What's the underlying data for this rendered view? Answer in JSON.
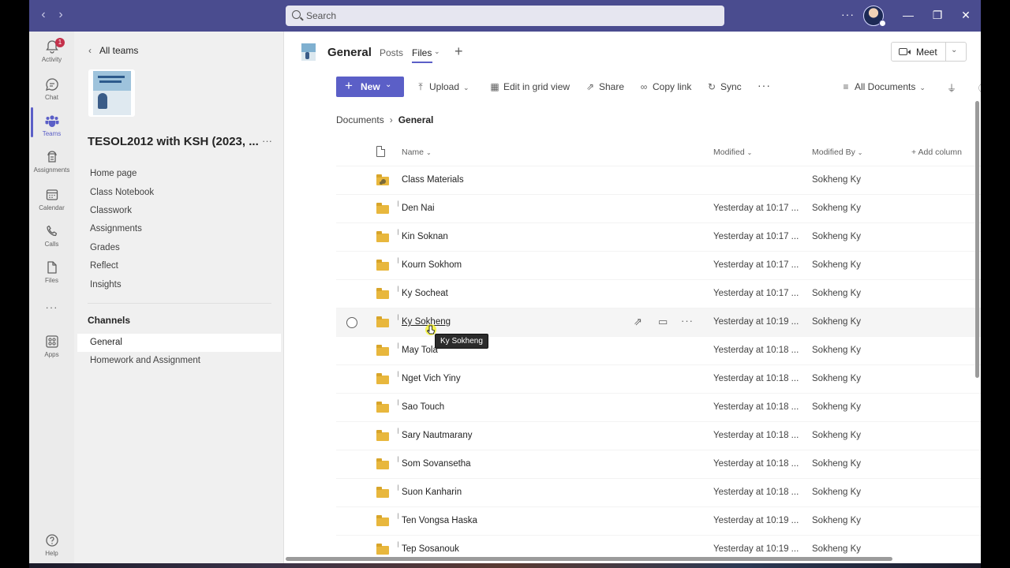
{
  "window": {
    "search_placeholder": "Search",
    "more_label": "···",
    "minimize": "—",
    "maximize": "❐",
    "close": "✕"
  },
  "rail": {
    "items": [
      {
        "label": "Activity",
        "icon": "bell-icon",
        "badge": "1"
      },
      {
        "label": "Chat",
        "icon": "chat-icon"
      },
      {
        "label": "Teams",
        "icon": "teams-icon"
      },
      {
        "label": "Assignments",
        "icon": "assignments-icon"
      },
      {
        "label": "Calendar",
        "icon": "calendar-icon"
      },
      {
        "label": "Calls",
        "icon": "phone-icon"
      },
      {
        "label": "Files",
        "icon": "file-icon"
      },
      {
        "label": "···",
        "icon": "more-icon"
      },
      {
        "label": "Apps",
        "icon": "apps-icon"
      }
    ],
    "help_label": "Help",
    "active": "Teams",
    "accent": "#5b5fc7"
  },
  "team": {
    "back_label": "All teams",
    "name": "TESOL2012 with KSH (2023, ...",
    "more_label": "···",
    "links": [
      "Home page",
      "Class Notebook",
      "Classwork",
      "Assignments",
      "Grades",
      "Reflect",
      "Insights"
    ],
    "channels_heading": "Channels",
    "channels": [
      "General",
      "Homework and Assignment"
    ],
    "active_channel": "General"
  },
  "main": {
    "title": "General",
    "tabs": [
      "Posts",
      "Files"
    ],
    "active_tab": "Files",
    "meet_label": "Meet",
    "toolbar": {
      "new_label": "New",
      "upload_label": "Upload",
      "grid_label": "Edit in grid view",
      "share_label": "Share",
      "copy_link_label": "Copy link",
      "sync_label": "Sync",
      "more_label": "···",
      "view_label": "All Documents"
    },
    "breadcrumb": [
      "Documents",
      "General"
    ],
    "columns": {
      "name": "Name",
      "modified": "Modified",
      "modified_by": "Modified By",
      "add_column": "+ Add column"
    },
    "rows": [
      {
        "name": "Class Materials",
        "modified": "",
        "modified_by": "Sokheng Ky",
        "shared": true
      },
      {
        "name": "Den Nai",
        "modified": "Yesterday at 10:17 ...",
        "modified_by": "Sokheng Ky"
      },
      {
        "name": "Kin Soknan",
        "modified": "Yesterday at 10:17 ...",
        "modified_by": "Sokheng Ky"
      },
      {
        "name": "Kourn Sokhom",
        "modified": "Yesterday at 10:17 ...",
        "modified_by": "Sokheng Ky"
      },
      {
        "name": "Ky Socheat",
        "modified": "Yesterday at 10:17 ...",
        "modified_by": "Sokheng Ky"
      },
      {
        "name": "Ky Sokheng",
        "modified": "Yesterday at 10:19 ...",
        "modified_by": "Sokheng Ky",
        "hover": true
      },
      {
        "name": "May Tola",
        "modified": "Yesterday at 10:18 ...",
        "modified_by": "Sokheng Ky"
      },
      {
        "name": "Nget Vich Yiny",
        "modified": "Yesterday at 10:18 ...",
        "modified_by": "Sokheng Ky"
      },
      {
        "name": "Sao Touch",
        "modified": "Yesterday at 10:18 ...",
        "modified_by": "Sokheng Ky"
      },
      {
        "name": "Sary Nautmarany",
        "modified": "Yesterday at 10:18 ...",
        "modified_by": "Sokheng Ky"
      },
      {
        "name": "Som Sovansetha",
        "modified": "Yesterday at 10:18 ...",
        "modified_by": "Sokheng Ky"
      },
      {
        "name": "Suon Kanharin",
        "modified": "Yesterday at 10:18 ...",
        "modified_by": "Sokheng Ky"
      },
      {
        "name": "Ten Vongsa Haska",
        "modified": "Yesterday at 10:19 ...",
        "modified_by": "Sokheng Ky"
      },
      {
        "name": "Tep Sosanouk",
        "modified": "Yesterday at 10:19 ...",
        "modified_by": "Sokheng Ky"
      }
    ],
    "tooltip": "Ky Sokheng"
  }
}
